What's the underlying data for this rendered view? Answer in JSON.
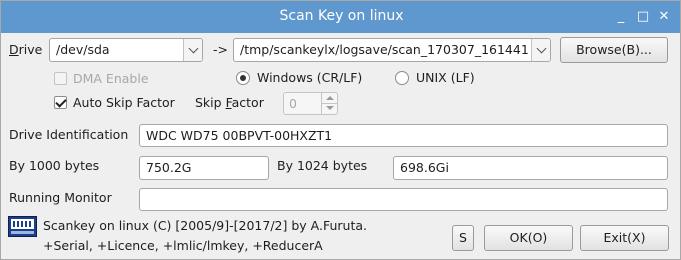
{
  "window": {
    "title": "Scan Key on linux",
    "controls": {
      "minimize": "_",
      "maximize": "□",
      "close": "✕"
    }
  },
  "drive": {
    "label_prefix": "D",
    "label_rest": "rive",
    "value": "/dev/sda",
    "arrow_text": "->",
    "logpath": "/tmp/scankeylx/logsave/scan_170307_161441",
    "browse_button": "Browse(B)..."
  },
  "options": {
    "dma_enable_label": "DMA Enable",
    "dma_enable_checked": false,
    "dma_enable_disabled": true,
    "newline_windows_label": "Windows (CR/LF)",
    "newline_unix_label": "UNIX (LF)",
    "newline_selected": "windows",
    "auto_skip_label": "Auto Skip Factor",
    "auto_skip_checked": true,
    "skip_factor_label_pre": "Skip ",
    "skip_factor_label_u": "F",
    "skip_factor_label_post": "actor",
    "skip_factor_value": "0"
  },
  "identification": {
    "label": "Drive Identification",
    "value": "WDC WD75 00BPVT-00HXZT1"
  },
  "sizes": {
    "by1000_label": "By 1000 bytes",
    "by1000_value": "750.2G",
    "by1024_label": "By 1024 bytes",
    "by1024_value": "698.6Gi"
  },
  "monitor": {
    "label": "Running Monitor",
    "value": ""
  },
  "footer": {
    "line1": "Scankey on linux (C) [2005/9]-[2017/2] by A.Furuta.",
    "line2": "+Serial, +Licence, +lmlic/lmkey, +ReducerA",
    "s_button": "S",
    "ok_button": "OK(O)",
    "exit_button": "Exit(X)"
  },
  "colors": {
    "titlebar": "#5f98ce",
    "window_bg": "#efefef"
  },
  "icons": {
    "app_icon": "disk-drive-icon"
  }
}
